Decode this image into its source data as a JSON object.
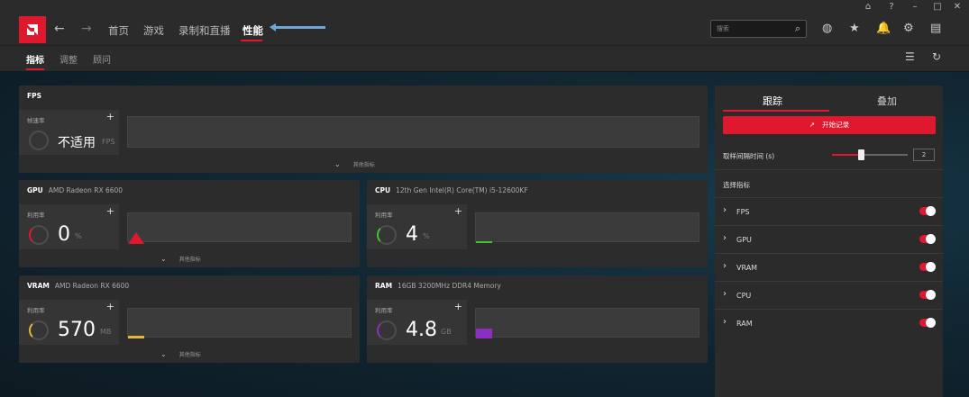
{
  "window": {
    "controls": [
      "⌂",
      "?",
      "–",
      "□",
      "✕"
    ]
  },
  "nav": {
    "back_icon": "←",
    "forward_icon": "→",
    "items": [
      "首页",
      "游戏",
      "录制和直播",
      "性能"
    ],
    "search_placeholder": "搜索",
    "search_icon": "⌕",
    "icons": [
      "◍",
      "★",
      "🔔",
      "⚙",
      "▤"
    ]
  },
  "subnav": {
    "items": [
      "指标",
      "调整",
      "顾问"
    ],
    "icons": [
      "☰",
      "↻"
    ]
  },
  "fps": {
    "title": "FPS",
    "card_label": "帧速率",
    "plus": "+",
    "value": "不适用",
    "unit": "FPS",
    "more": "其他指标",
    "chev": "⌄"
  },
  "gpu": {
    "title": "GPU",
    "subtitle": "AMD Radeon RX 6600",
    "card_label": "利用率",
    "plus": "+",
    "value": "0",
    "unit": "%",
    "more": "其他指标",
    "chev": "⌄"
  },
  "cpu": {
    "title": "CPU",
    "subtitle": "12th Gen Intel(R) Core(TM) i5-12600KF",
    "card_label": "利用率",
    "plus": "+",
    "value": "4",
    "unit": "%"
  },
  "vram": {
    "title": "VRAM",
    "subtitle": "AMD Radeon RX 6600",
    "card_label": "利用率",
    "plus": "+",
    "value": "570",
    "unit": "MB",
    "more": "其他指标",
    "chev": "⌄"
  },
  "ram": {
    "title": "RAM",
    "subtitle": "16GB 3200MHz DDR4 Memory",
    "card_label": "利用率",
    "plus": "+",
    "value": "4.8",
    "unit": "GB"
  },
  "right_panel": {
    "tabs": [
      "跟踪",
      "叠加"
    ],
    "record_label": "开始记录",
    "record_icon": "↗",
    "interval_label": "取样间隔时间 (s)",
    "interval_value": "2",
    "select_label": "选择指标",
    "chev": "›",
    "metrics": [
      "FPS",
      "GPU",
      "VRAM",
      "CPU",
      "RAM"
    ]
  },
  "colors": {
    "accent": "#e0182d",
    "gpu_mark": "#e0182d",
    "cpu_mark": "#44c23a",
    "vram_mark": "#e0b83a",
    "ram_mark": "#8a2fc0"
  }
}
